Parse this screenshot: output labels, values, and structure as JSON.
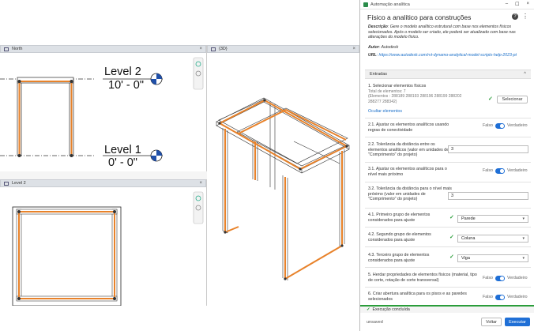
{
  "north_view": {
    "tab": "North",
    "level2_name": "Level 2",
    "level2_elev": "10' - 0\"",
    "level1_name": "Level 1",
    "level1_elev": "0' - 0\""
  },
  "view3d": {
    "tab": "{3D}"
  },
  "level2_view": {
    "tab": "Level 2"
  },
  "panel": {
    "window_title": "Automação analítica",
    "title": "Físico a analítico para construções",
    "desc_label": "Descrição",
    "desc_text": ": Gere o modelo analítico estrutural com base nos elementos físicos selecionados. Após o modelo ser criado, ele poderá ser atualizado com base nas alterações do modelo físico.",
    "author_label": "Autor",
    "author": ": Autodesk",
    "url_label": "URL",
    "url": ": https://www.autodesk.com/rvt-dynamo-analytical-model-scripts-help-2023-pt",
    "section": "Entradas",
    "i1_label": "1. Selecionar elementos físicos",
    "i1_total": "Total de elementos: 7",
    "i1_ids": "(Elementos : 288189 288193 288196 288199 288202 288277 288342)",
    "i1_button": "Selecionar",
    "i1_hide": "Ocultar elementos",
    "i21": "2.1. Ajustar os elementos analíticos usando regras de conectividade",
    "i22": "2.2. Tolerância da distância entre os elementos analíticos (valor em unidades de \"Comprimento\" do projeto)",
    "i22_val": "3",
    "i31": "3.1. Ajustar os elementos analíticos para o nível mais próximo",
    "i32": "3.2. Tolerância da distância para o nível mais próximo (valor em unidades de \"Comprimento\" do projeto)",
    "i32_val": "3",
    "i41": "4.1. Primeiro grupo de elementos considerados para ajuste",
    "i41_val": "Parede",
    "i42": "4.2. Segundo grupo de elementos considerados para ajuste",
    "i42_val": "Coluna",
    "i43": "4.3. Terceiro grupo de elementos considerados para ajuste",
    "i43_val": "Viga",
    "i5": "5. Herdar propriedades de elementos físicos (material, tipo de corte, rotação de corte transversal)",
    "i6": "6. Criar abertura analítica para os pisos e as paredes selecionados",
    "false": "Falso",
    "true": "Verdadeiro",
    "status": "Execução concluída",
    "unsaved": "unsaved",
    "back": "Voltar",
    "run": "Executar"
  },
  "colors": {
    "accent": "#1f6fd6",
    "orange": "#e8822a",
    "ok": "#2a9d3a"
  }
}
